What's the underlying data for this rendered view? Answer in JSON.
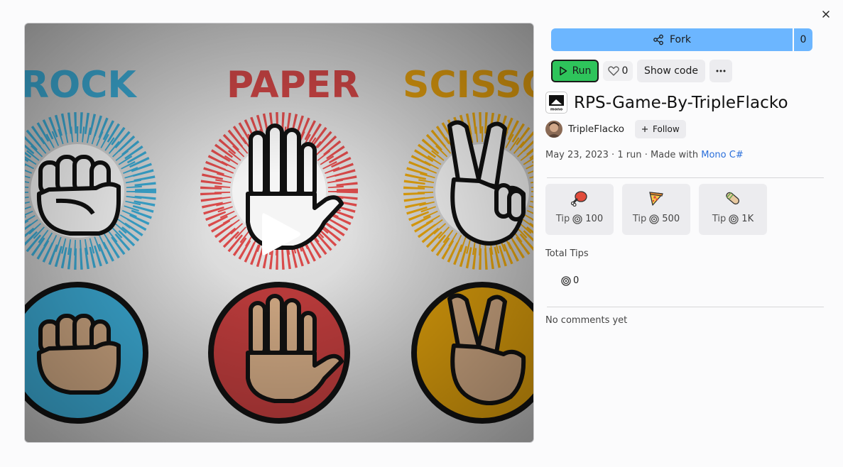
{
  "window": {
    "close_icon": "close-icon"
  },
  "cover": {
    "words": [
      "ROCK",
      "PAPER",
      "SCISSO"
    ],
    "colors": {
      "rock": "#3aa6cf",
      "paper": "#d94a4a",
      "scissors": "#e3a20e",
      "skin": "#c9a37f"
    },
    "play_icon": "play-icon"
  },
  "fork": {
    "label": "Fork",
    "count": "0",
    "icon": "fork-icon",
    "color": "#6cb6ff"
  },
  "actions": {
    "run_label": "Run",
    "run_color": "#2ec45b",
    "like_count": "0",
    "show_code_label": "Show code",
    "more_icon": "more-icon"
  },
  "repl": {
    "title": "RPS-Game-By-TripleFlacko",
    "logo_text": "mono",
    "author": "TripleFlacko",
    "follow_label": "Follow",
    "date": "May 23, 2023",
    "runs": "1 run",
    "made_with_prefix": "Made with",
    "language": "Mono C#"
  },
  "tips": [
    {
      "icon": "meat-icon",
      "label": "Tip",
      "amount": "100"
    },
    {
      "icon": "pizza-icon",
      "label": "Tip",
      "amount": "500"
    },
    {
      "icon": "burrito-icon",
      "label": "Tip",
      "amount": "1K"
    }
  ],
  "total_tips": {
    "label": "Total Tips",
    "value": "0"
  },
  "comments": {
    "empty_text": "No comments yet"
  }
}
